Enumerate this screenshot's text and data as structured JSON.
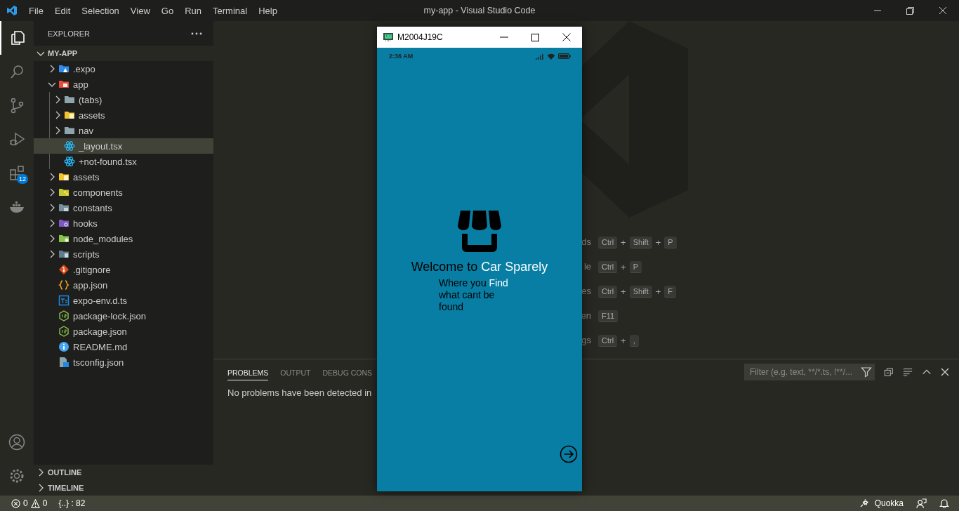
{
  "title_bar": {
    "menu": [
      "File",
      "Edit",
      "Selection",
      "View",
      "Go",
      "Run",
      "Terminal",
      "Help"
    ],
    "title": "my-app - Visual Studio Code"
  },
  "activity_bar": {
    "items": [
      {
        "kind": "files",
        "selected": true
      },
      {
        "kind": "search",
        "selected": false
      },
      {
        "kind": "source-control",
        "selected": false
      },
      {
        "kind": "run-debug",
        "selected": false
      },
      {
        "kind": "extensions",
        "selected": false,
        "badge": "12"
      },
      {
        "kind": "docker",
        "selected": false
      }
    ],
    "bottom": [
      {
        "kind": "account"
      },
      {
        "kind": "settings"
      }
    ]
  },
  "explorer": {
    "title": "EXPLORER",
    "root": {
      "label": "MY-APP",
      "expanded": true
    },
    "tree": [
      {
        "label": ".expo",
        "kind": "expo",
        "expanded": false,
        "selected": false
      },
      {
        "label": "app",
        "kind": "app",
        "expanded": true,
        "selected": false,
        "children": [
          {
            "label": "(tabs)",
            "kind": "folder",
            "expanded": false,
            "selected": false
          },
          {
            "label": "assets",
            "kind": "assets",
            "expanded": false,
            "selected": false
          },
          {
            "label": "nav",
            "kind": "folder",
            "expanded": false,
            "selected": false
          },
          {
            "label": "_layout.tsx",
            "kind": "react",
            "selected": true
          },
          {
            "label": "+not-found.tsx",
            "kind": "react",
            "selected": false
          }
        ]
      },
      {
        "label": "assets",
        "kind": "assets",
        "expanded": false,
        "selected": false
      },
      {
        "label": "components",
        "kind": "components",
        "expanded": false,
        "selected": false
      },
      {
        "label": "constants",
        "kind": "constants",
        "expanded": false,
        "selected": false
      },
      {
        "label": "hooks",
        "kind": "hooks",
        "expanded": false,
        "selected": false
      },
      {
        "label": "node_modules",
        "kind": "node",
        "expanded": false,
        "selected": false
      },
      {
        "label": "scripts",
        "kind": "scripts",
        "expanded": false,
        "selected": false
      },
      {
        "label": ".gitignore",
        "kind": "git",
        "selected": false
      },
      {
        "label": "app.json",
        "kind": "json",
        "selected": false
      },
      {
        "label": "expo-env.d.ts",
        "kind": "ts",
        "selected": false
      },
      {
        "label": "package-lock.json",
        "kind": "js",
        "selected": false
      },
      {
        "label": "package.json",
        "kind": "js",
        "selected": false
      },
      {
        "label": "README.md",
        "kind": "info",
        "selected": false
      },
      {
        "label": "tsconfig.json",
        "kind": "tsconfig",
        "selected": false
      }
    ],
    "sections": [
      {
        "label": "OUTLINE",
        "expanded": false
      },
      {
        "label": "TIMELINE",
        "expanded": false
      }
    ]
  },
  "editor": {
    "shortcuts": [
      {
        "label": "ds",
        "keys": [
          {
            "kind": "key",
            "text": "Ctrl"
          },
          {
            "kind": "plus",
            "text": "+"
          },
          {
            "kind": "key",
            "text": "Shift"
          },
          {
            "kind": "plus",
            "text": "+"
          },
          {
            "kind": "key",
            "text": "P"
          }
        ]
      },
      {
        "label": "le",
        "keys": [
          {
            "kind": "key",
            "text": "Ctrl"
          },
          {
            "kind": "plus",
            "text": "+"
          },
          {
            "kind": "key",
            "text": "P"
          }
        ]
      },
      {
        "label": "es",
        "keys": [
          {
            "kind": "key",
            "text": "Ctrl"
          },
          {
            "kind": "plus",
            "text": "+"
          },
          {
            "kind": "key",
            "text": "Shift"
          },
          {
            "kind": "plus",
            "text": "+"
          },
          {
            "kind": "key",
            "text": "F"
          }
        ]
      },
      {
        "label": "en",
        "keys": [
          {
            "kind": "key",
            "text": "F11"
          }
        ]
      },
      {
        "label": "gs",
        "keys": [
          {
            "kind": "key",
            "text": "Ctrl"
          },
          {
            "kind": "plus",
            "text": "+"
          },
          {
            "kind": "key",
            "text": ","
          }
        ]
      }
    ]
  },
  "panel": {
    "tabs": [
      {
        "label": "PROBLEMS",
        "selected": true
      },
      {
        "label": "OUTPUT",
        "selected": false
      },
      {
        "label": "DEBUG CONS",
        "selected": false
      }
    ],
    "message": "No problems have been detected in",
    "filter": {
      "placeholder": "Filter (e.g. text, **/*.ts, !**/..."
    }
  },
  "emulator": {
    "title": "M2004J19C",
    "time": "2:36 AM",
    "heading": [
      {
        "text": "Welcome to ",
        "highlight": false
      },
      {
        "text": "Car Sparely",
        "highlight": true
      }
    ],
    "tagline": [
      {
        "text": "Where you ",
        "highlight": false
      },
      {
        "text": "Find",
        "highlight": true
      },
      {
        "text": " what cant be found",
        "highlight": false
      }
    ]
  },
  "status_bar": {
    "errors": "0",
    "warnings": "0",
    "brackets": "{..} : 82",
    "quokka": "Quokka"
  }
}
